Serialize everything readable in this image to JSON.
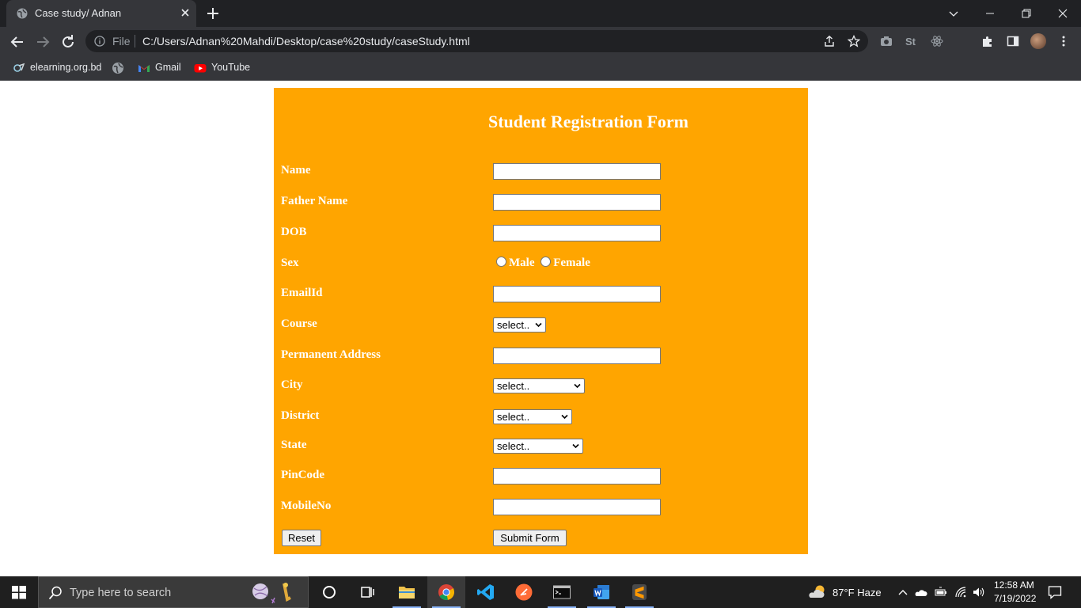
{
  "browser": {
    "tab_title": "Case study/ Adnan",
    "url_scheme_label": "File",
    "url": "C:/Users/Adnan%20Mahdi/Desktop/case%20study/caseStudy.html",
    "bookmarks": [
      {
        "label": "elearning.org.bd",
        "icon": "elearning-icon"
      },
      {
        "label": "",
        "icon": "globe-icon"
      },
      {
        "label": "Gmail",
        "icon": "gmail-icon"
      },
      {
        "label": "YouTube",
        "icon": "youtube-icon"
      }
    ]
  },
  "form": {
    "title": "Student Registration Form",
    "fields": {
      "name": {
        "label": "Name",
        "value": ""
      },
      "father_name": {
        "label": "Father Name",
        "value": ""
      },
      "dob": {
        "label": "DOB",
        "value": ""
      },
      "sex": {
        "label": "Sex",
        "options": [
          "Male",
          "Female"
        ],
        "selected": null
      },
      "email": {
        "label": "EmailId",
        "value": ""
      },
      "course": {
        "label": "Course",
        "selected": "select.."
      },
      "address": {
        "label": "Permanent Address",
        "value": ""
      },
      "city": {
        "label": "City",
        "selected": "select.."
      },
      "district": {
        "label": "District",
        "selected": "select.."
      },
      "state": {
        "label": "State",
        "selected": "select.."
      },
      "pincode": {
        "label": "PinCode",
        "value": ""
      },
      "mobile": {
        "label": "MobileNo",
        "value": ""
      }
    },
    "buttons": {
      "reset": "Reset",
      "submit": "Submit Form"
    },
    "colors": {
      "panel": "#ffa500",
      "label_text": "#ffffff"
    }
  },
  "taskbar": {
    "search_placeholder": "Type here to search",
    "weather": "87°F  Haze",
    "time": "12:58 AM",
    "date": "7/19/2022"
  }
}
